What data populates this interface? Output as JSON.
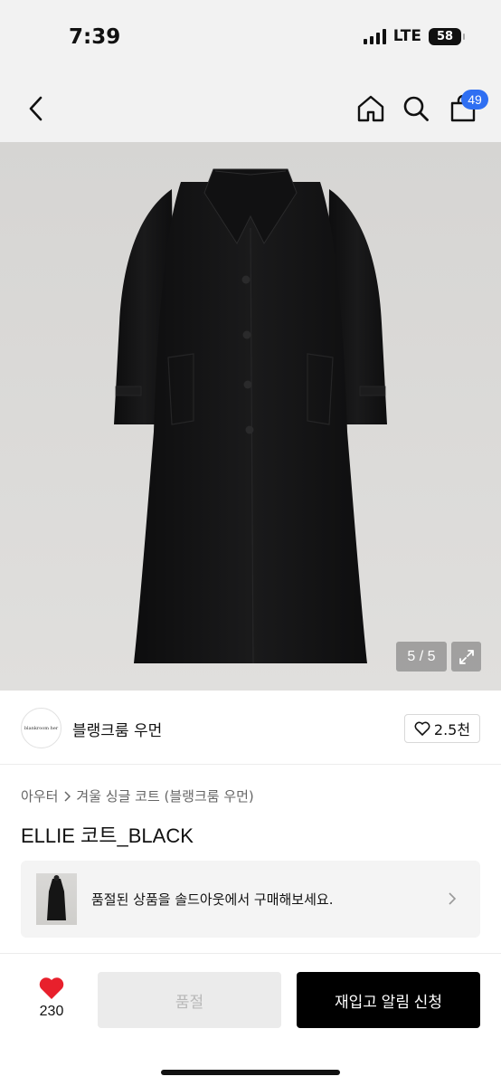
{
  "status_bar": {
    "time": "7:39",
    "network": "LTE",
    "battery": "58"
  },
  "nav": {
    "cart_badge": "49"
  },
  "gallery": {
    "counter": "5 / 5"
  },
  "brand": {
    "logo_text": "blankroom her",
    "name": "블랭크룸 우먼",
    "likes": "2.5천"
  },
  "breadcrumb": {
    "category": "아우터",
    "subcategory": "겨울 싱글 코트 (블랭크룸 우먼)"
  },
  "product": {
    "title": "ELLIE 코트_BLACK"
  },
  "soldout_banner": {
    "text": "품절된 상품을 솔드아웃에서 구매해보세요."
  },
  "bottom_bar": {
    "heart_count": "230",
    "soldout_label": "품절",
    "restock_label": "재입고 알림 신청"
  },
  "colors": {
    "badge": "#2f6ff2",
    "heart": "#e8202c",
    "primary_button": "#000000",
    "disabled_button": "#ebebeb"
  }
}
